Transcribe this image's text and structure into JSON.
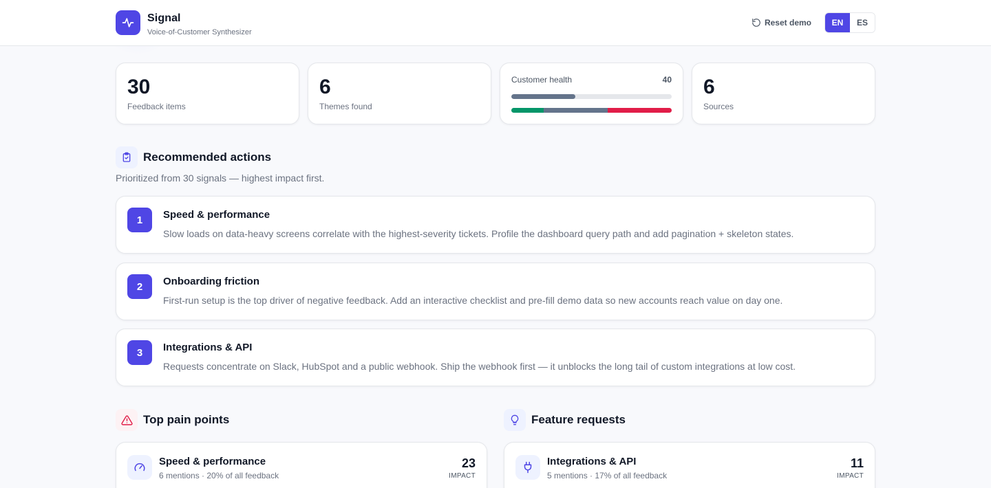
{
  "header": {
    "app_name": "Signal",
    "app_subtitle": "Voice-of-Customer Synthesizer",
    "reset_label": "Reset demo",
    "languages": [
      {
        "code": "EN",
        "active": true
      },
      {
        "code": "ES",
        "active": false
      }
    ]
  },
  "stats": {
    "feedback": {
      "value": "30",
      "label": "Feedback items"
    },
    "themes": {
      "value": "6",
      "label": "Themes found"
    },
    "health": {
      "label": "Customer health",
      "value": "40",
      "score_fraction": 0.4,
      "sentiment_split": {
        "positive": 0.2,
        "neutral": 0.4,
        "negative": 0.4
      },
      "colors": {
        "positive": "#059669",
        "neutral": "#64748b",
        "negative": "#e11d48"
      }
    },
    "sources": {
      "value": "6",
      "label": "Sources"
    }
  },
  "recommended": {
    "title": "Recommended actions",
    "subtitle": "Prioritized from 30 signals — highest impact first.",
    "icon": "clipboard-check-icon",
    "items": [
      {
        "rank": "1",
        "title": "Speed & performance",
        "desc": "Slow loads on data-heavy screens correlate with the highest-severity tickets. Profile the dashboard query path and add pagination + skeleton states."
      },
      {
        "rank": "2",
        "title": "Onboarding friction",
        "desc": "First-run setup is the top driver of negative feedback. Add an interactive checklist and pre-fill demo data so new accounts reach value on day one."
      },
      {
        "rank": "3",
        "title": "Integrations & API",
        "desc": "Requests concentrate on Slack, HubSpot and a public webhook. Ship the webhook first — it unblocks the long tail of custom integrations at low cost."
      }
    ]
  },
  "pain_points": {
    "title": "Top pain points",
    "icon": "alert-triangle-icon",
    "items": [
      {
        "title": "Speed & performance",
        "meta": "6 mentions · 20% of all feedback",
        "impact": "23",
        "impact_label": "IMPACT",
        "icon": "gauge-icon"
      }
    ]
  },
  "feature_requests": {
    "title": "Feature requests",
    "icon": "lightbulb-icon",
    "items": [
      {
        "title": "Integrations & API",
        "meta": "5 mentions · 17% of all feedback",
        "impact": "11",
        "impact_label": "IMPACT",
        "icon": "plug-icon"
      }
    ]
  },
  "theme": {
    "accent": "#4f46e5",
    "danger": "#e11d48",
    "muted": "#6b7280"
  }
}
